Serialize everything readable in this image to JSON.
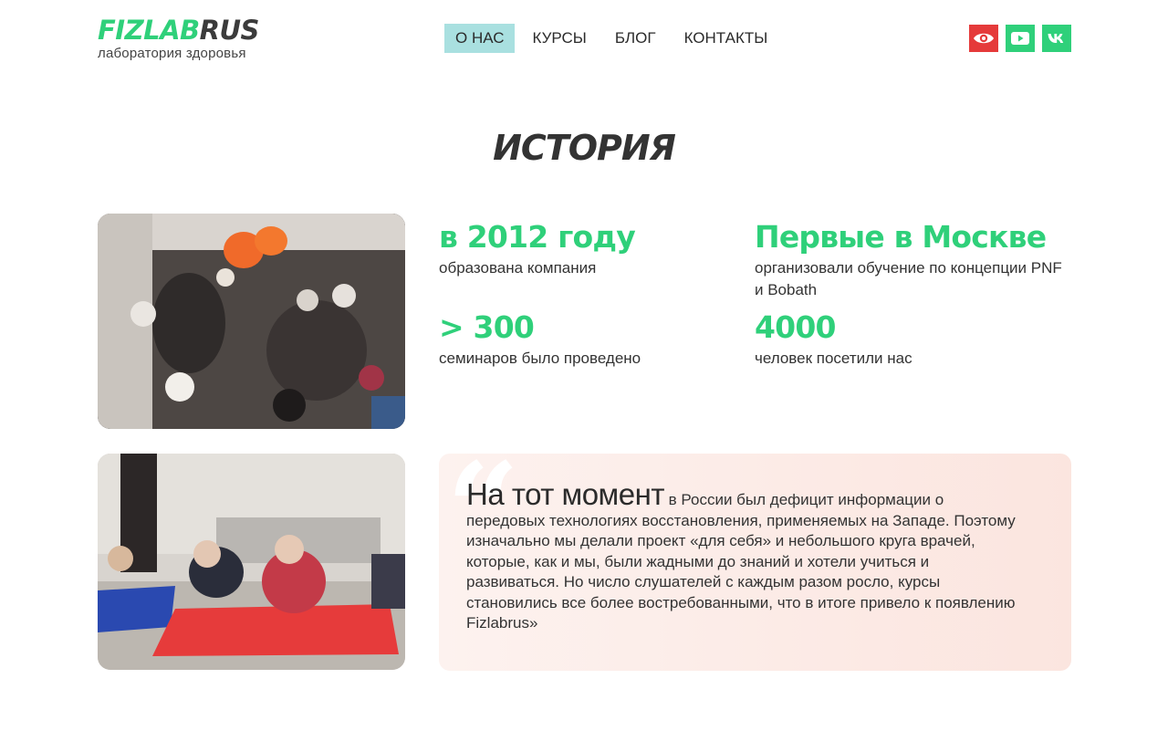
{
  "logo": {
    "part1": "FIZLAB",
    "part2": "RUS",
    "subtitle": "лаборатория здоровья"
  },
  "nav": {
    "items": [
      "О НАС",
      "КУРСЫ",
      "БЛОГ",
      "КОНТАКТЫ"
    ],
    "active": "О НАС"
  },
  "socials": [
    "eye-icon",
    "youtube-icon",
    "vk-icon"
  ],
  "title": "ИСТОРИЯ",
  "stats": [
    {
      "value": "в 2012 году",
      "desc": "образована компания"
    },
    {
      "value": "Первые в Москве",
      "desc": "организовали обучение по концепции PNF и Bobath"
    },
    {
      "value": "> 300",
      "desc": "семинаров было проведено"
    },
    {
      "value": "4000",
      "desc": "человек посетили нас"
    }
  ],
  "quote": {
    "lead": "На тот момент",
    "text": " в России был дефицит информации о передовых технологиях восстановления, применяемых на Западе. Поэтому изначально мы делали проект «для себя» и небольшого круга врачей, которые, как и мы, были жадными до знаний и хотели учиться и развиваться. Но число слушателей с каждым разом росло, курсы становились все более востребованными, что в итоге привело к появлению Fizlabrus»"
  },
  "colors": {
    "accent": "#2fd07a",
    "nav_active_bg": "#a9e0e0",
    "eye_bg": "#e53a3a"
  }
}
